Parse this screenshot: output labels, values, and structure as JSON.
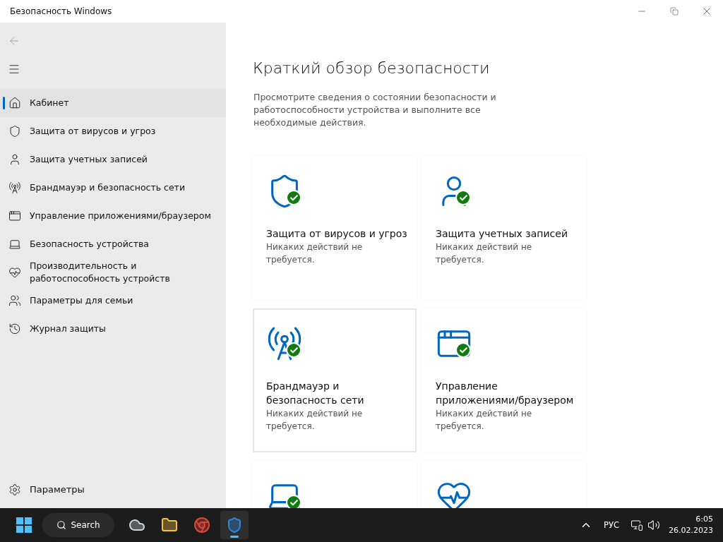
{
  "window": {
    "title": "Безопасность Windows"
  },
  "sidebar": {
    "items": [
      {
        "kind": "home",
        "label": "Кабинет",
        "selected": true
      },
      {
        "kind": "shield",
        "label": "Защита от вирусов и угроз",
        "selected": false
      },
      {
        "kind": "user",
        "label": "Защита учетных записей",
        "selected": false
      },
      {
        "kind": "antenna",
        "label": "Брандмауэр и безопасность сети",
        "selected": false
      },
      {
        "kind": "browser",
        "label": "Управление приложениями/браузером",
        "selected": false
      },
      {
        "kind": "laptop",
        "label": "Безопасность устройства",
        "selected": false
      },
      {
        "kind": "heart",
        "label": "Производительность и работоспособность устройств",
        "selected": false
      },
      {
        "kind": "family",
        "label": "Параметры для семьи",
        "selected": false
      },
      {
        "kind": "history",
        "label": "Журнал защиты",
        "selected": false
      }
    ],
    "settings": {
      "label": "Параметры"
    }
  },
  "main": {
    "title": "Краткий обзор безопасности",
    "description": "Просмотрите сведения о состоянии безопасности и работоспособности устройства и выполните все необходимые действия.",
    "cards": [
      {
        "kind": "shield",
        "ok": true,
        "highlighted": false,
        "title": "Защита от вирусов и угроз",
        "status": "Никаких действий не требуется."
      },
      {
        "kind": "user",
        "ok": true,
        "highlighted": false,
        "title": "Защита учетных записей",
        "status": "Никаких действий не требуется."
      },
      {
        "kind": "antenna",
        "ok": true,
        "highlighted": true,
        "title": "Брандмауэр и безопасность сети",
        "status": "Никаких действий не требуется."
      },
      {
        "kind": "browser",
        "ok": true,
        "highlighted": false,
        "title": "Управление приложениями/браузером",
        "status": "Никаких действий не требуется."
      },
      {
        "kind": "laptop",
        "ok": true,
        "highlighted": false
      },
      {
        "kind": "heart",
        "highlighted": false
      }
    ]
  },
  "taskbar": {
    "search": "Search",
    "apps": [
      {
        "kind": "weather",
        "active": false
      },
      {
        "kind": "folder",
        "active": false
      },
      {
        "kind": "browser",
        "active": false
      },
      {
        "kind": "shield",
        "active": true
      }
    ],
    "language": "РУС",
    "time": "6:05",
    "date": "26.02.2023"
  }
}
